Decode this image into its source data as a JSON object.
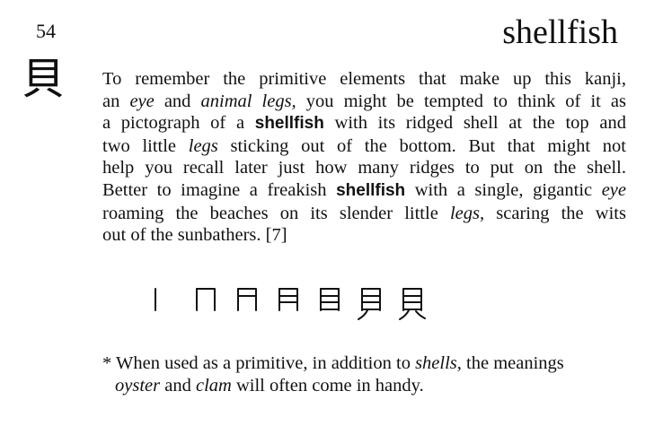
{
  "frame_number": "54",
  "kanji": "貝",
  "keyword": "shellfish",
  "story": {
    "lines": [
      [
        {
          "t": "To remember the primitive elements that make up this kanji,",
          "s": "normal"
        }
      ],
      [
        {
          "t": "an ",
          "s": "normal"
        },
        {
          "t": "eye",
          "s": "em"
        },
        {
          "t": " and ",
          "s": "normal"
        },
        {
          "t": "animal legs,",
          "s": "em"
        },
        {
          "t": " you might be tempted to think of it as",
          "s": "normal"
        }
      ],
      [
        {
          "t": "a pictograph of a ",
          "s": "normal"
        },
        {
          "t": "shellfish",
          "s": "kw"
        },
        {
          "t": " with its ridged shell at the top and",
          "s": "normal"
        }
      ],
      [
        {
          "t": "two little ",
          "s": "normal"
        },
        {
          "t": "legs",
          "s": "em"
        },
        {
          "t": " sticking out of the bottom. But that might not",
          "s": "normal"
        }
      ],
      [
        {
          "t": "help you recall later just how many ridges to put on the shell.",
          "s": "normal"
        }
      ],
      [
        {
          "t": "Better to imagine a freakish ",
          "s": "normal"
        },
        {
          "t": "shellfish",
          "s": "kw"
        },
        {
          "t": " with a single, gigantic ",
          "s": "normal"
        },
        {
          "t": "eye",
          "s": "em"
        }
      ],
      [
        {
          "t": "roaming the beaches on its slender little ",
          "s": "normal"
        },
        {
          "t": "legs,",
          "s": "em"
        },
        {
          "t": " scaring the wits",
          "s": "normal"
        }
      ],
      [
        {
          "t": "out of the sunbathers. [7]",
          "s": "normal"
        }
      ]
    ]
  },
  "stroke_order_steps": 7,
  "footnote": {
    "marker": "*",
    "lines": [
      [
        {
          "t": "When used as a primitive, in addition to ",
          "s": "normal"
        },
        {
          "t": "shells,",
          "s": "em"
        },
        {
          "t": " the meanings",
          "s": "normal"
        }
      ],
      [
        {
          "t": "oyster",
          "s": "em"
        },
        {
          "t": " and ",
          "s": "normal"
        },
        {
          "t": "clam",
          "s": "em"
        },
        {
          "t": " will often come in handy.",
          "s": "normal"
        }
      ]
    ]
  }
}
